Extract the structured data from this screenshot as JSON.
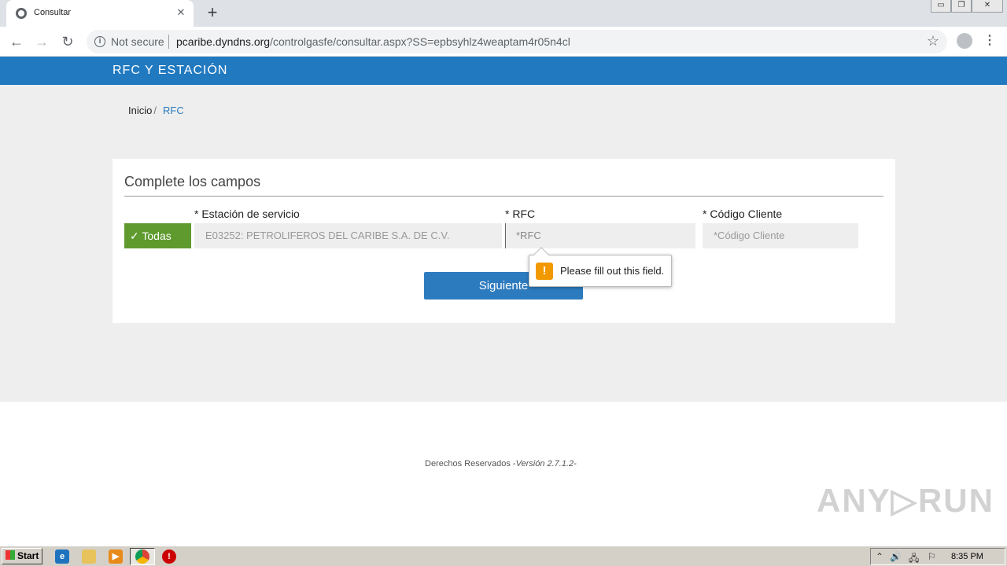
{
  "browser": {
    "tab_title": "Consultar",
    "tab_close": "✕",
    "new_tab": "+",
    "back": "←",
    "forward": "→",
    "reload": "↻",
    "info": "i",
    "security_text": "Not secure",
    "url_host": "pcaribe.dyndns.org",
    "url_path": "/controlgasfe/consultar.aspx?SS=epbsyhlz4weaptam4r05n4cl",
    "bookmark_star": "☆",
    "menu": "⋮",
    "window_controls": [
      "▭",
      "❐",
      "✕"
    ]
  },
  "header": {
    "title": "RFC Y ESTACIÓN"
  },
  "breadcrumb": {
    "home": "Inicio",
    "separator": "/",
    "current": "RFC"
  },
  "form": {
    "title": "Complete los campos",
    "todas_label": "✓ Todas",
    "station_label": "* Estación de servicio",
    "station_value": "E03252: PETROLIFEROS DEL CARIBE S.A. DE C.V.",
    "rfc_label": "* RFC",
    "rfc_placeholder": "*RFC",
    "client_label": "* Código Cliente",
    "client_placeholder": "*Código Cliente",
    "submit_label": "Siguiente"
  },
  "validation": {
    "icon": "!",
    "message": "Please fill out this field."
  },
  "footer": {
    "text": "Derechos Reservados -",
    "version": "Versión 2.7.1.2",
    "trail": "-"
  },
  "watermark": "ANY▷RUN",
  "taskbar": {
    "start_label": "Start",
    "clock": "8:35 PM",
    "tray_icons": [
      "⌃",
      "🔊",
      "🖧",
      "⚐"
    ]
  },
  "colors": {
    "header_blue": "#2179c0",
    "button_blue": "#2d7bbf",
    "todas_green": "#5e9a2e",
    "warning_orange": "#f29900"
  }
}
